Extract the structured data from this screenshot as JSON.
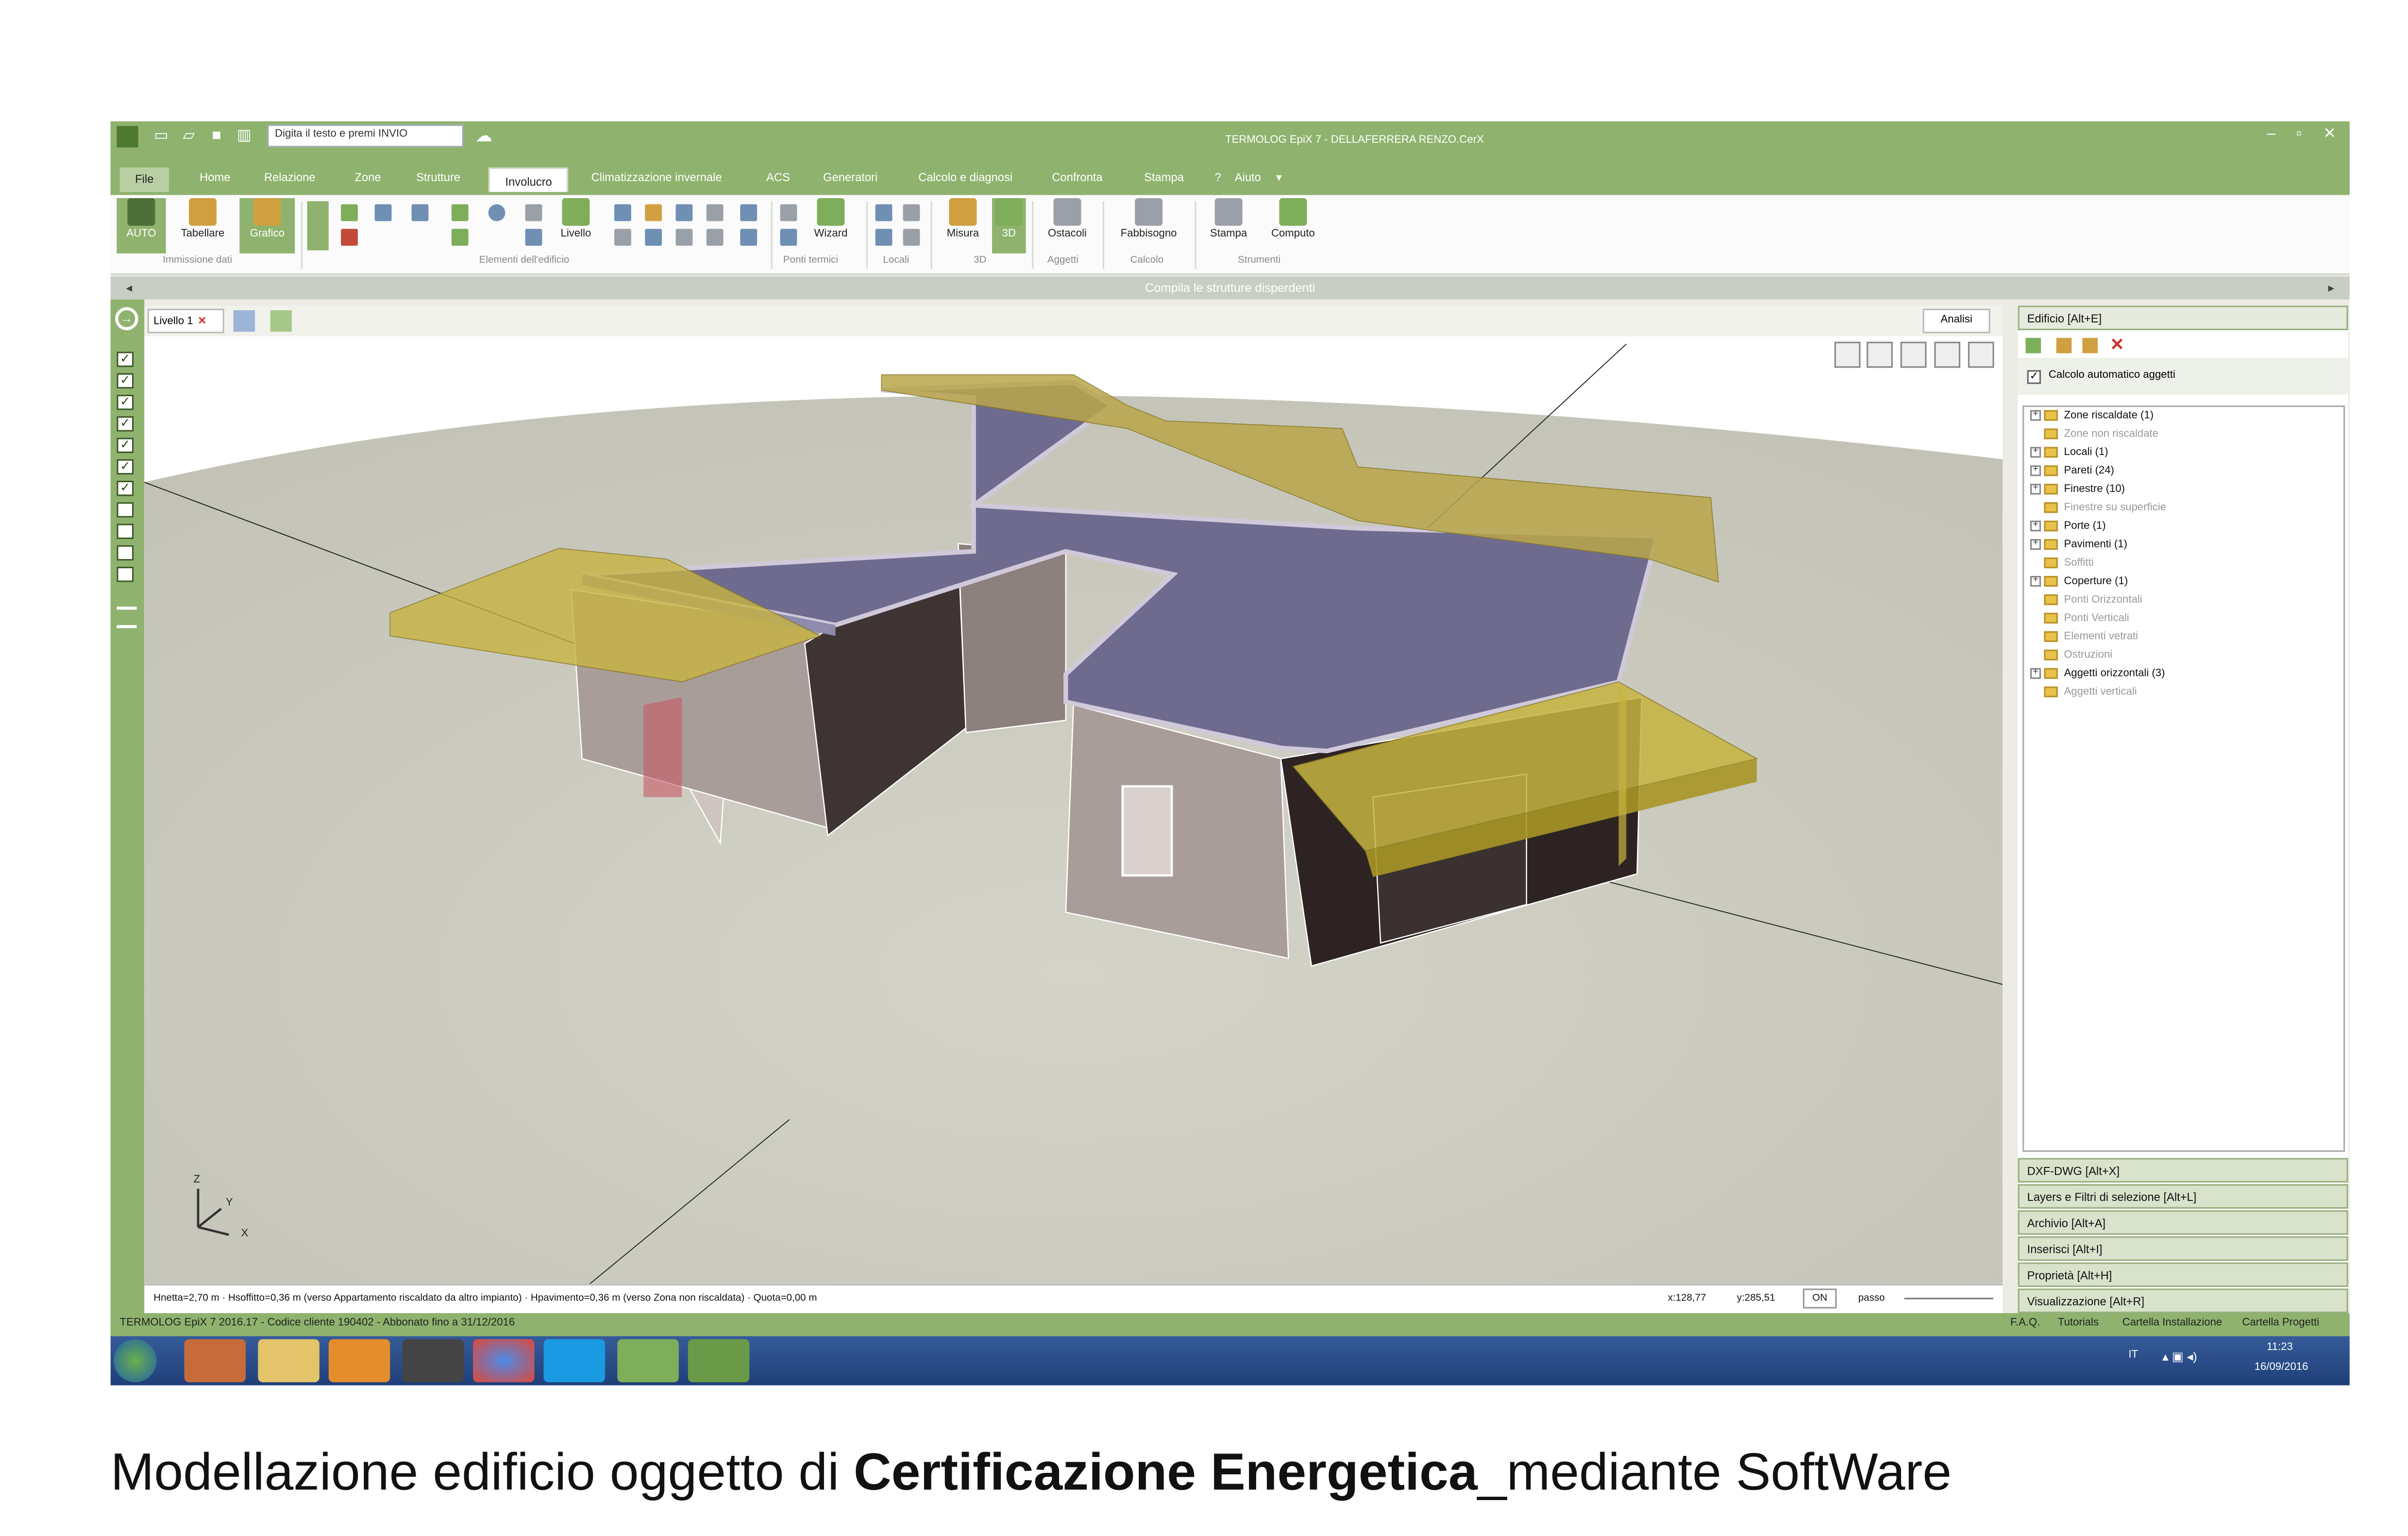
{
  "window": {
    "search_placeholder": "Digita il testo e premi INVIO",
    "title": "TERMOLOG EpiX 7 - DELLAFERRERA RENZO.CerX"
  },
  "tabs": [
    "File",
    "Home",
    "Relazione",
    "Zone",
    "Strutture",
    "Involucro",
    "Climatizzazione invernale",
    "ACS",
    "Generatori",
    "Calcolo e diagnosi",
    "Confronta",
    "Stampa",
    "Aiuto"
  ],
  "active_tab": "Involucro",
  "ribbon": {
    "buttons": {
      "auto": "AUTO",
      "tabellare": "Tabellare",
      "grafico": "Grafico",
      "livello": "Livello",
      "wizard": "Wizard",
      "misura": "Misura",
      "d3": "3D",
      "ostacoli": "Ostacoli",
      "fabbisogno": "Fabbisogno",
      "stampa": "Stampa",
      "computo": "Computo"
    },
    "groups": {
      "immissione": "Immissione dati",
      "elementi": "Elementi dell'edificio",
      "ponti": "Ponti termici",
      "locali": "Locali",
      "d3": "3D",
      "aggetti": "Aggetti",
      "calcolo": "Calcolo",
      "strumenti": "Strumenti"
    }
  },
  "command_hint": "Compila le strutture disperdenti",
  "view": {
    "level_tab": "Livello 1",
    "analysis_button": "Analisi",
    "axis_z": "Z",
    "axis_y": "Y",
    "axis_x": "X"
  },
  "status": {
    "text": "Hnetta=2,70 m · Hsoffitto=0,36 m (verso Appartamento riscaldato da altro impianto) · Hpavimento=0,36 m (verso Zona non riscaldata) · Quota=0,00 m",
    "x": "x:128,77",
    "y": "y:285,51",
    "on": "ON",
    "passo": "passo"
  },
  "panel": {
    "header": "Edificio [Alt+E]",
    "auto_calc": "Calcolo automatico aggetti",
    "tree": [
      {
        "label": "Zone riscaldate (1)",
        "on": true
      },
      {
        "label": "Zone non riscaldate",
        "on": false
      },
      {
        "label": "Locali (1)",
        "on": true
      },
      {
        "label": "Pareti (24)",
        "on": true
      },
      {
        "label": "Finestre (10)",
        "on": true
      },
      {
        "label": "Finestre su superficie",
        "on": false
      },
      {
        "label": "Porte (1)",
        "on": true
      },
      {
        "label": "Pavimenti (1)",
        "on": true
      },
      {
        "label": "Soffitti",
        "on": false
      },
      {
        "label": "Coperture (1)",
        "on": true
      },
      {
        "label": "Ponti Orizzontali",
        "on": false
      },
      {
        "label": "Ponti Verticali",
        "on": false
      },
      {
        "label": "Elementi vetrati",
        "on": false
      },
      {
        "label": "Ostruzioni",
        "on": false
      },
      {
        "label": "Aggetti orizzontali (3)",
        "on": true
      },
      {
        "label": "Aggetti verticali",
        "on": false
      }
    ],
    "sections": [
      "DXF-DWG [Alt+X]",
      "Layers e Filtri di selezione [Alt+L]",
      "Archivio [Alt+A]",
      "Inserisci [Alt+I]",
      "Proprietà [Alt+H]",
      "Visualizzazione [Alt+R]"
    ]
  },
  "footer": {
    "left": "TERMOLOG EpiX 7 2016.17 - Codice cliente 190402 - Abbonato fino a 31/12/2016",
    "links": [
      "F.A.Q.",
      "Tutorials",
      "Cartella Installazione",
      "Cartella Progetti"
    ]
  },
  "taskbar": {
    "lang": "IT",
    "time": "11:23",
    "date": "16/09/2016"
  },
  "caption": {
    "pre": "Modellazione edificio oggetto di ",
    "bold": "Certificazione Energetica",
    "post": "_mediante SoftWare"
  }
}
